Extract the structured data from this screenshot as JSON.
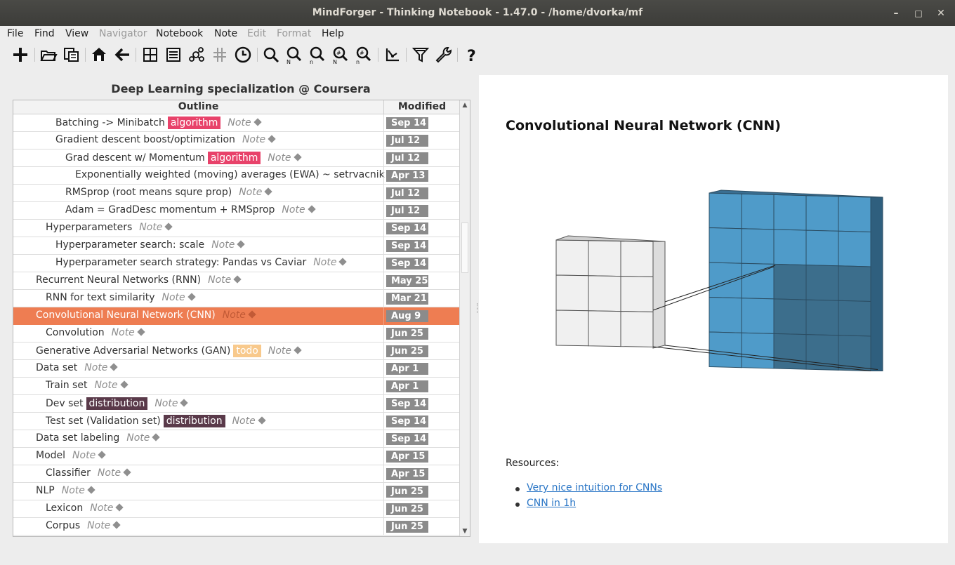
{
  "window": {
    "title": "MindForger - Thinking Notebook - 1.47.0 - /home/dvorka/mf",
    "controls": [
      "–",
      "□",
      "✕"
    ]
  },
  "menu": [
    {
      "label": "File",
      "enabled": true
    },
    {
      "label": "Find",
      "enabled": true
    },
    {
      "label": "View",
      "enabled": true
    },
    {
      "label": "Navigator",
      "enabled": false
    },
    {
      "label": "Notebook",
      "enabled": true
    },
    {
      "label": "Note",
      "enabled": true
    },
    {
      "label": "Edit",
      "enabled": false
    },
    {
      "label": "Format",
      "enabled": false
    },
    {
      "label": "Help",
      "enabled": true
    }
  ],
  "toolbar": {
    "icons": [
      "plus-icon",
      "folder-open-icon",
      "notebooks-icon",
      "home-icon",
      "back-arrow-icon",
      "grid-icon",
      "list-icon",
      "network-icon",
      "hash-icon",
      "clock-icon",
      "search-icon",
      "search-note-icon",
      "search-notebook-icon",
      "search-tag-icon",
      "search-regex-icon",
      "graph-icon",
      "filter-icon",
      "wrench-icon",
      "help-icon"
    ]
  },
  "notebook": {
    "title": "Deep Learning specialization @ Coursera",
    "columns": {
      "outline": "Outline",
      "modified": "Modified"
    },
    "note_label": "Note",
    "rows": [
      {
        "title": "Batching -> Minibatch",
        "depth": 2,
        "tag": "algorithm",
        "tag_color": "#e8426a",
        "modified": "Sep 14"
      },
      {
        "title": "Gradient descent boost/optimization",
        "depth": 2,
        "tag": "",
        "modified": "Jul 12"
      },
      {
        "title": "Grad descent w/ Momentum",
        "depth": 3,
        "tag": "algorithm",
        "tag_color": "#e8426a",
        "modified": "Jul 12"
      },
      {
        "title": "Exponentially weighted (moving) averages (EWA) ~ setrvacnik",
        "depth": 4,
        "tag": "",
        "note_visible": "N",
        "modified": "Apr 13"
      },
      {
        "title": "RMSprop (root means squre prop)",
        "depth": 3,
        "tag": "",
        "modified": "Jul 12"
      },
      {
        "title": "Adam = GradDesc momentum + RMSprop",
        "depth": 3,
        "tag": "",
        "modified": "Jul 12"
      },
      {
        "title": "Hyperparameters",
        "depth": 1,
        "tag": "",
        "modified": "Sep 14"
      },
      {
        "title": "Hyperparameter search: scale",
        "depth": 2,
        "tag": "",
        "modified": "Sep 14"
      },
      {
        "title": "Hyperparameter search strategy: Pandas vs Caviar",
        "depth": 2,
        "tag": "",
        "modified": "Sep 14"
      },
      {
        "title": "Recurrent Neural Networks (RNN)",
        "depth": 0,
        "tag": "",
        "modified": "May 25"
      },
      {
        "title": "RNN for text similarity",
        "depth": 1,
        "tag": "",
        "modified": "Mar 21"
      },
      {
        "title": "Convolutional Neural Network (CNN)",
        "depth": 0,
        "tag": "",
        "modified": "Aug  9",
        "selected": true
      },
      {
        "title": "Convolution",
        "depth": 1,
        "tag": "",
        "modified": "Jun 25"
      },
      {
        "title": "Generative Adversarial Networks (GAN)",
        "depth": 0,
        "tag": "todo",
        "tag_color": "#f8c98c",
        "modified": "Jun 25"
      },
      {
        "title": "Data set",
        "depth": 0,
        "tag": "",
        "modified": "Apr  1"
      },
      {
        "title": "Train set",
        "depth": 1,
        "tag": "",
        "modified": "Apr  1"
      },
      {
        "title": "Dev set",
        "depth": 1,
        "tag": "distribution",
        "tag_color": "#5a3a4a",
        "modified": "Sep 14"
      },
      {
        "title": "Test set (Validation set)",
        "depth": 1,
        "tag": "distribution",
        "tag_color": "#5a3a4a",
        "modified": "Sep 14"
      },
      {
        "title": "Data set labeling",
        "depth": 0,
        "tag": "",
        "modified": "Sep 14"
      },
      {
        "title": "Model",
        "depth": 0,
        "tag": "",
        "modified": "Apr 15"
      },
      {
        "title": "Classifier",
        "depth": 1,
        "tag": "",
        "modified": "Apr 15"
      },
      {
        "title": "NLP",
        "depth": 0,
        "tag": "",
        "modified": "Jun 25"
      },
      {
        "title": "Lexicon",
        "depth": 1,
        "tag": "",
        "modified": "Jun 25"
      },
      {
        "title": "Corpus",
        "depth": 1,
        "tag": "",
        "modified": "Jun 25"
      }
    ]
  },
  "preview": {
    "heading": "Convolutional Neural Network (CNN)",
    "resources_label": "Resources:",
    "links": [
      "Very nice intuition for CNNs",
      "CNN in 1h"
    ]
  }
}
